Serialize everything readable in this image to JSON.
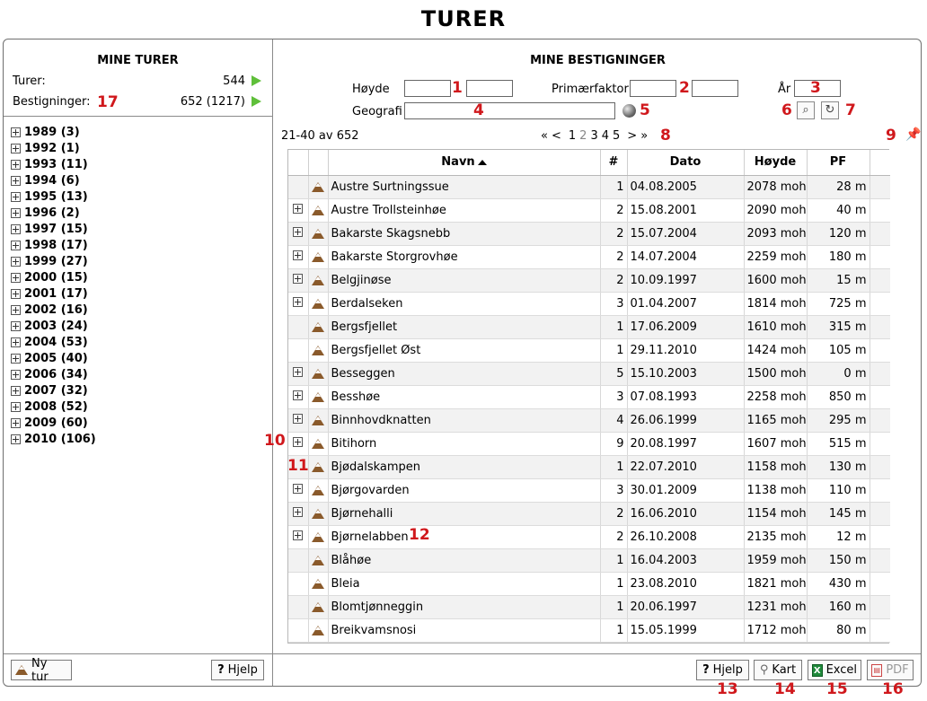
{
  "page_title": "TURER",
  "left": {
    "title": "MINE TURER",
    "turer_label": "Turer:",
    "turer_value": "544",
    "bestigninger_label": "Bestigninger:",
    "bestigninger_value": "652 (1217)",
    "years": [
      "1989 (3)",
      "1992 (1)",
      "1993 (11)",
      "1994 (6)",
      "1995 (13)",
      "1996 (2)",
      "1997 (15)",
      "1998 (17)",
      "1999 (27)",
      "2000 (15)",
      "2001 (17)",
      "2002 (16)",
      "2003 (24)",
      "2004 (53)",
      "2005 (40)",
      "2006 (34)",
      "2007 (32)",
      "2008 (52)",
      "2009 (60)",
      "2010 (106)"
    ],
    "new_tour_label": "Ny tur",
    "help_label": "Hjelp"
  },
  "right": {
    "title": "MINE BESTIGNINGER",
    "filter": {
      "hoyde_label": "Høyde",
      "primaer_label": "Primærfaktor",
      "ar_label": "År",
      "geografi_label": "Geografi"
    },
    "pager": {
      "info": "21-40 av 652",
      "first": "«",
      "prev": "<",
      "pages": [
        "1",
        "2",
        "3",
        "4",
        "5"
      ],
      "current": "2",
      "next": ">",
      "last": "»"
    },
    "table": {
      "headers": {
        "navn": "Navn",
        "count": "#",
        "dato": "Dato",
        "hoyde": "Høyde",
        "pf": "PF"
      },
      "rows": [
        {
          "expand": false,
          "navn": "Austre Surtningssue",
          "count": "1",
          "dato": "04.08.2005",
          "hoyde": "2078 moh",
          "pf": "28 m"
        },
        {
          "expand": true,
          "navn": "Austre Trollsteinhøe",
          "count": "2",
          "dato": "15.08.2001",
          "hoyde": "2090 moh",
          "pf": "40 m"
        },
        {
          "expand": true,
          "navn": "Bakarste Skagsnebb",
          "count": "2",
          "dato": "15.07.2004",
          "hoyde": "2093 moh",
          "pf": "120 m"
        },
        {
          "expand": true,
          "navn": "Bakarste Storgrovhøe",
          "count": "2",
          "dato": "14.07.2004",
          "hoyde": "2259 moh",
          "pf": "180 m"
        },
        {
          "expand": true,
          "navn": "Belgjinøse",
          "count": "2",
          "dato": "10.09.1997",
          "hoyde": "1600 moh",
          "pf": "15 m"
        },
        {
          "expand": true,
          "navn": "Berdalseken",
          "count": "3",
          "dato": "01.04.2007",
          "hoyde": "1814 moh",
          "pf": "725 m"
        },
        {
          "expand": false,
          "navn": "Bergsfjellet",
          "count": "1",
          "dato": "17.06.2009",
          "hoyde": "1610 moh",
          "pf": "315 m"
        },
        {
          "expand": false,
          "navn": "Bergsfjellet Øst",
          "count": "1",
          "dato": "29.11.2010",
          "hoyde": "1424 moh",
          "pf": "105 m"
        },
        {
          "expand": true,
          "navn": "Besseggen",
          "count": "5",
          "dato": "15.10.2003",
          "hoyde": "1500 moh",
          "pf": "0 m"
        },
        {
          "expand": true,
          "navn": "Besshøe",
          "count": "3",
          "dato": "07.08.1993",
          "hoyde": "2258 moh",
          "pf": "850 m"
        },
        {
          "expand": true,
          "navn": "Binnhovdknatten",
          "count": "4",
          "dato": "26.06.1999",
          "hoyde": "1165 moh",
          "pf": "295 m"
        },
        {
          "expand": true,
          "navn": "Bitihorn",
          "count": "9",
          "dato": "20.08.1997",
          "hoyde": "1607 moh",
          "pf": "515 m"
        },
        {
          "expand": false,
          "navn": "Bjødalskampen",
          "count": "1",
          "dato": "22.07.2010",
          "hoyde": "1158 moh",
          "pf": "130 m"
        },
        {
          "expand": true,
          "navn": "Bjørgovarden",
          "count": "3",
          "dato": "30.01.2009",
          "hoyde": "1138 moh",
          "pf": "110 m"
        },
        {
          "expand": true,
          "navn": "Bjørnehalli",
          "count": "2",
          "dato": "16.06.2010",
          "hoyde": "1154 moh",
          "pf": "145 m"
        },
        {
          "expand": true,
          "navn": "Bjørnelabben",
          "count": "2",
          "dato": "26.10.2008",
          "hoyde": "2135 moh",
          "pf": "12 m"
        },
        {
          "expand": false,
          "navn": "Blåhøe",
          "count": "1",
          "dato": "16.04.2003",
          "hoyde": "1959 moh",
          "pf": "150 m"
        },
        {
          "expand": false,
          "navn": "Bleia",
          "count": "1",
          "dato": "23.08.2010",
          "hoyde": "1821 moh",
          "pf": "430 m"
        },
        {
          "expand": false,
          "navn": "Blomtjønneggin",
          "count": "1",
          "dato": "20.06.1997",
          "hoyde": "1231 moh",
          "pf": "160 m"
        },
        {
          "expand": false,
          "navn": "Breikvamsnosi",
          "count": "1",
          "dato": "15.05.1999",
          "hoyde": "1712 moh",
          "pf": "80 m"
        }
      ]
    },
    "buttons": {
      "help": "Hjelp",
      "kart": "Kart",
      "excel": "Excel",
      "pdf": "PDF"
    }
  },
  "annotations": [
    "1",
    "2",
    "3",
    "4",
    "5",
    "6",
    "7",
    "8",
    "9",
    "10",
    "11",
    "12",
    "13",
    "14",
    "15",
    "16",
    "17"
  ]
}
